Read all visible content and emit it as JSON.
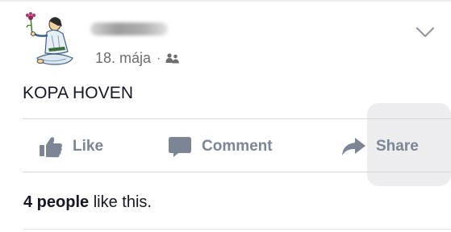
{
  "post": {
    "author_name": "",
    "date": "18. mája",
    "separator": "·",
    "audience_icon": "friends-icon",
    "menu_icon": "chevron-down-icon",
    "text": "KOPA HOVEN",
    "likes": {
      "count_text": "4 people",
      "suffix": " like this."
    }
  },
  "actions": {
    "like_label": "Like",
    "like_icon": "thumbs-up-icon",
    "comment_label": "Comment",
    "comment_icon": "speech-bubble-icon",
    "share_label": "Share",
    "share_icon": "share-arrow-icon"
  },
  "colors": {
    "action_gray": "#7b8594",
    "meta_gray": "#6d6d6d",
    "text": "#141823",
    "divider": "#d3d6db"
  }
}
